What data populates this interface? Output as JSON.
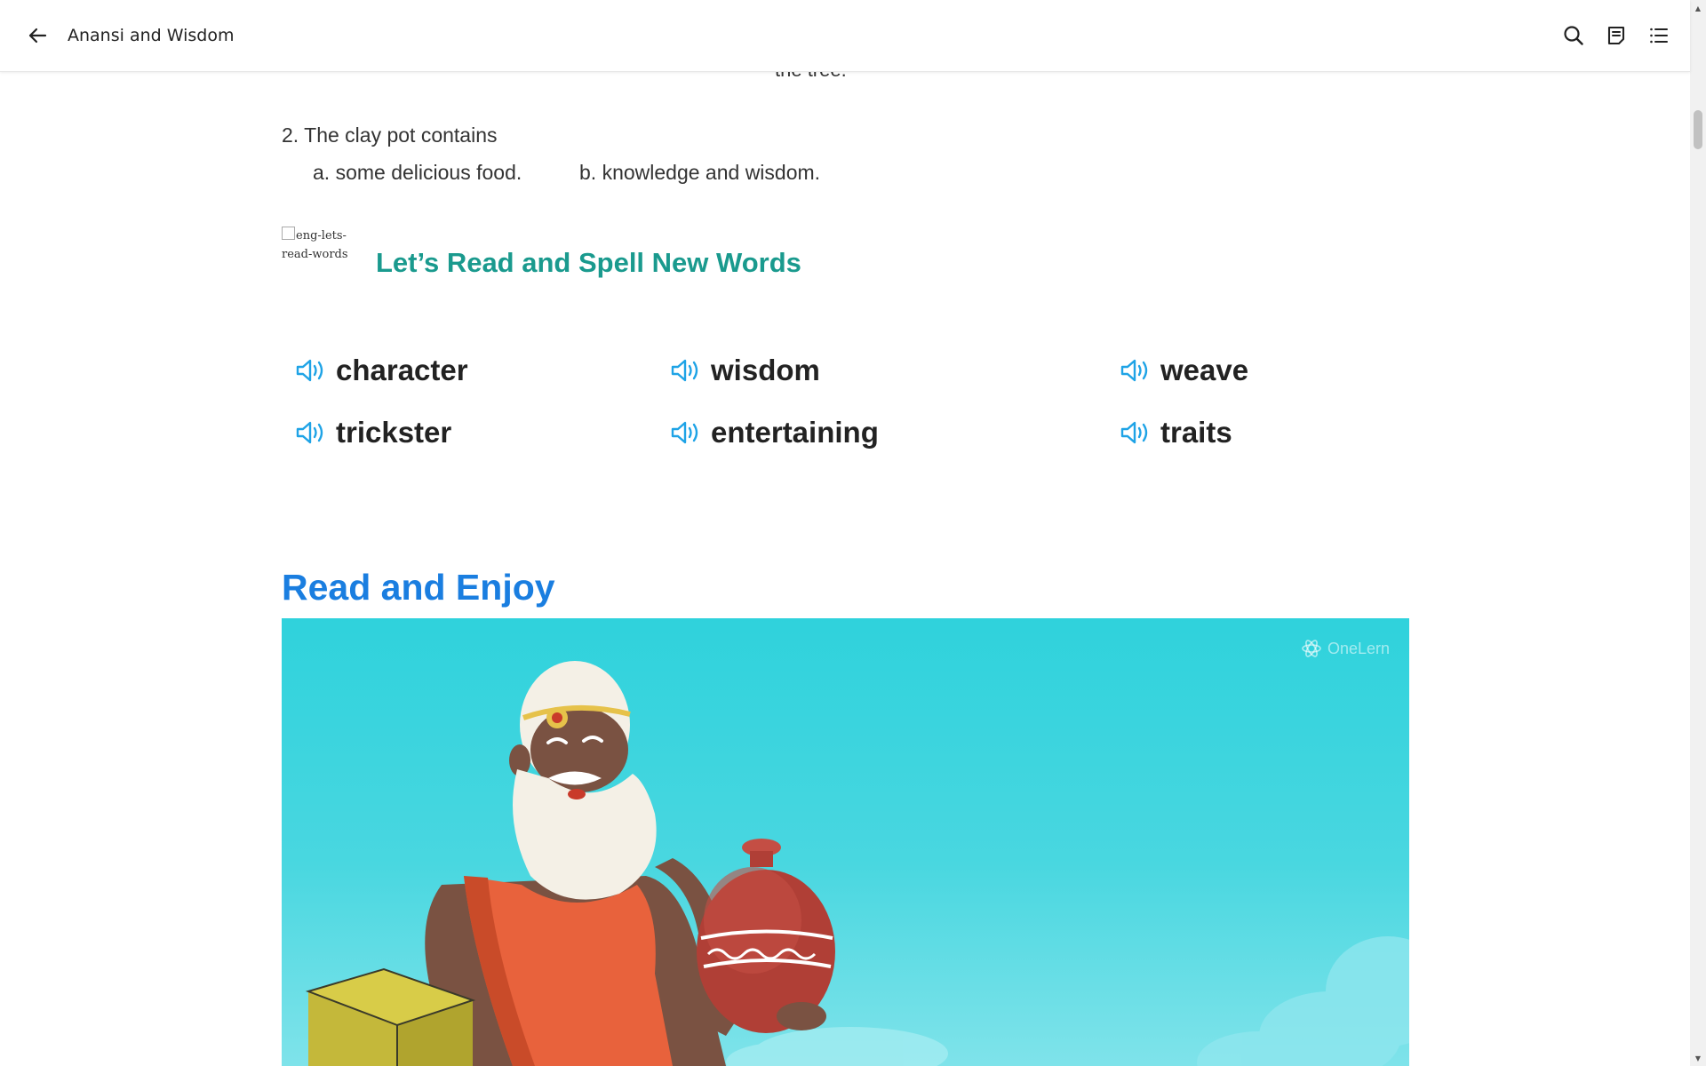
{
  "header": {
    "title": "Anansi and Wisdom",
    "back_icon": "arrow-left-icon",
    "search_icon": "search-icon",
    "notes_icon": "notes-icon",
    "toc_icon": "list-icon"
  },
  "quiz": {
    "cut_line": "the tree.",
    "question_2": "2. The clay pot contains",
    "option_a": "a. some delicious food.",
    "option_b": "b. knowledge and wisdom."
  },
  "spell_section": {
    "image_alt": "eng-lets-read-words",
    "title": "Let’s Read and Spell New Words",
    "speaker_icon": "speaker-icon",
    "words": [
      "character",
      "wisdom",
      "weave",
      "trickster",
      "entertaining",
      "traits"
    ]
  },
  "read_section": {
    "title": "Read and Enjoy",
    "watermark": "OneLern"
  },
  "colors": {
    "section_title": "#1a9a8e",
    "read_title": "#1a7ee0",
    "speaker": "#1ea3e6",
    "scene_sky": "#2fd2dc"
  }
}
